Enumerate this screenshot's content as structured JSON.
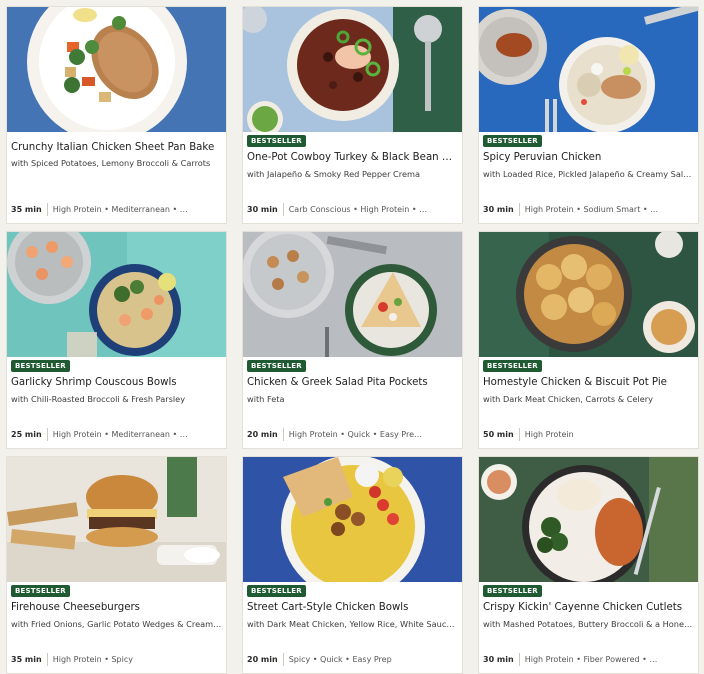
{
  "badge_label": "BESTSELLER",
  "colors": {
    "badge_bg": "#1f5a32",
    "card_bg": "#ffffff",
    "page_bg": "#f3f1ec"
  },
  "recipes": [
    {
      "title": "Crunchy Italian Chicken Sheet Pan Bake",
      "subtitle": "with Spiced Potatoes, Lemony Broccoli & Carrots",
      "time": "35 min",
      "tags": "High Protein • Mediterranean • …",
      "bestseller": false,
      "image": "chicken-sheet-pan-photo"
    },
    {
      "title": "One-Pot Cowboy Turkey & Black Bean C…",
      "subtitle": "with Jalapeño & Smoky Red Pepper Crema",
      "time": "30 min",
      "tags": "Carb Conscious • High Protein • …",
      "bestseller": true,
      "image": "turkey-bean-chili-photo"
    },
    {
      "title": "Spicy Peruvian Chicken",
      "subtitle": "with Loaded Rice, Pickled Jalapeño & Creamy Salsa…",
      "time": "30 min",
      "tags": "High Protein • Sodium Smart • …",
      "bestseller": true,
      "image": "peruvian-chicken-photo"
    },
    {
      "title": "Garlicky Shrimp Couscous Bowls",
      "subtitle": "with Chili-Roasted Broccoli & Fresh Parsley",
      "time": "25 min",
      "tags": "High Protein • Mediterranean • …",
      "bestseller": true,
      "image": "shrimp-couscous-photo"
    },
    {
      "title": "Chicken & Greek Salad Pita Pockets",
      "subtitle": "with Feta",
      "time": "20 min",
      "tags": "High Protein • Quick • Easy Pre…",
      "bestseller": true,
      "image": "pita-pockets-photo"
    },
    {
      "title": "Homestyle Chicken & Biscuit Pot Pie",
      "subtitle": "with Dark Meat Chicken, Carrots & Celery",
      "time": "50 min",
      "tags": "High Protein",
      "bestseller": true,
      "image": "pot-pie-photo"
    },
    {
      "title": "Firehouse Cheeseburgers",
      "subtitle": "with Fried Onions, Garlic Potato Wedges & Creamy …",
      "time": "35 min",
      "tags": "High Protein • Spicy",
      "bestseller": true,
      "image": "cheeseburger-photo"
    },
    {
      "title": "Street Cart-Style Chicken Bowls",
      "subtitle": "with Dark Meat Chicken, Yellow Rice, White Sauce …",
      "time": "20 min",
      "tags": "Spicy • Quick • Easy Prep",
      "bestseller": true,
      "image": "chicken-bowl-photo"
    },
    {
      "title": "Crispy Kickin' Cayenne Chicken Cutlets",
      "subtitle": "with Mashed Potatoes, Buttery Broccoli & a Honey …",
      "time": "30 min",
      "tags": "High Protein • Fiber Powered • …",
      "bestseller": true,
      "image": "chicken-cutlets-photo"
    }
  ]
}
